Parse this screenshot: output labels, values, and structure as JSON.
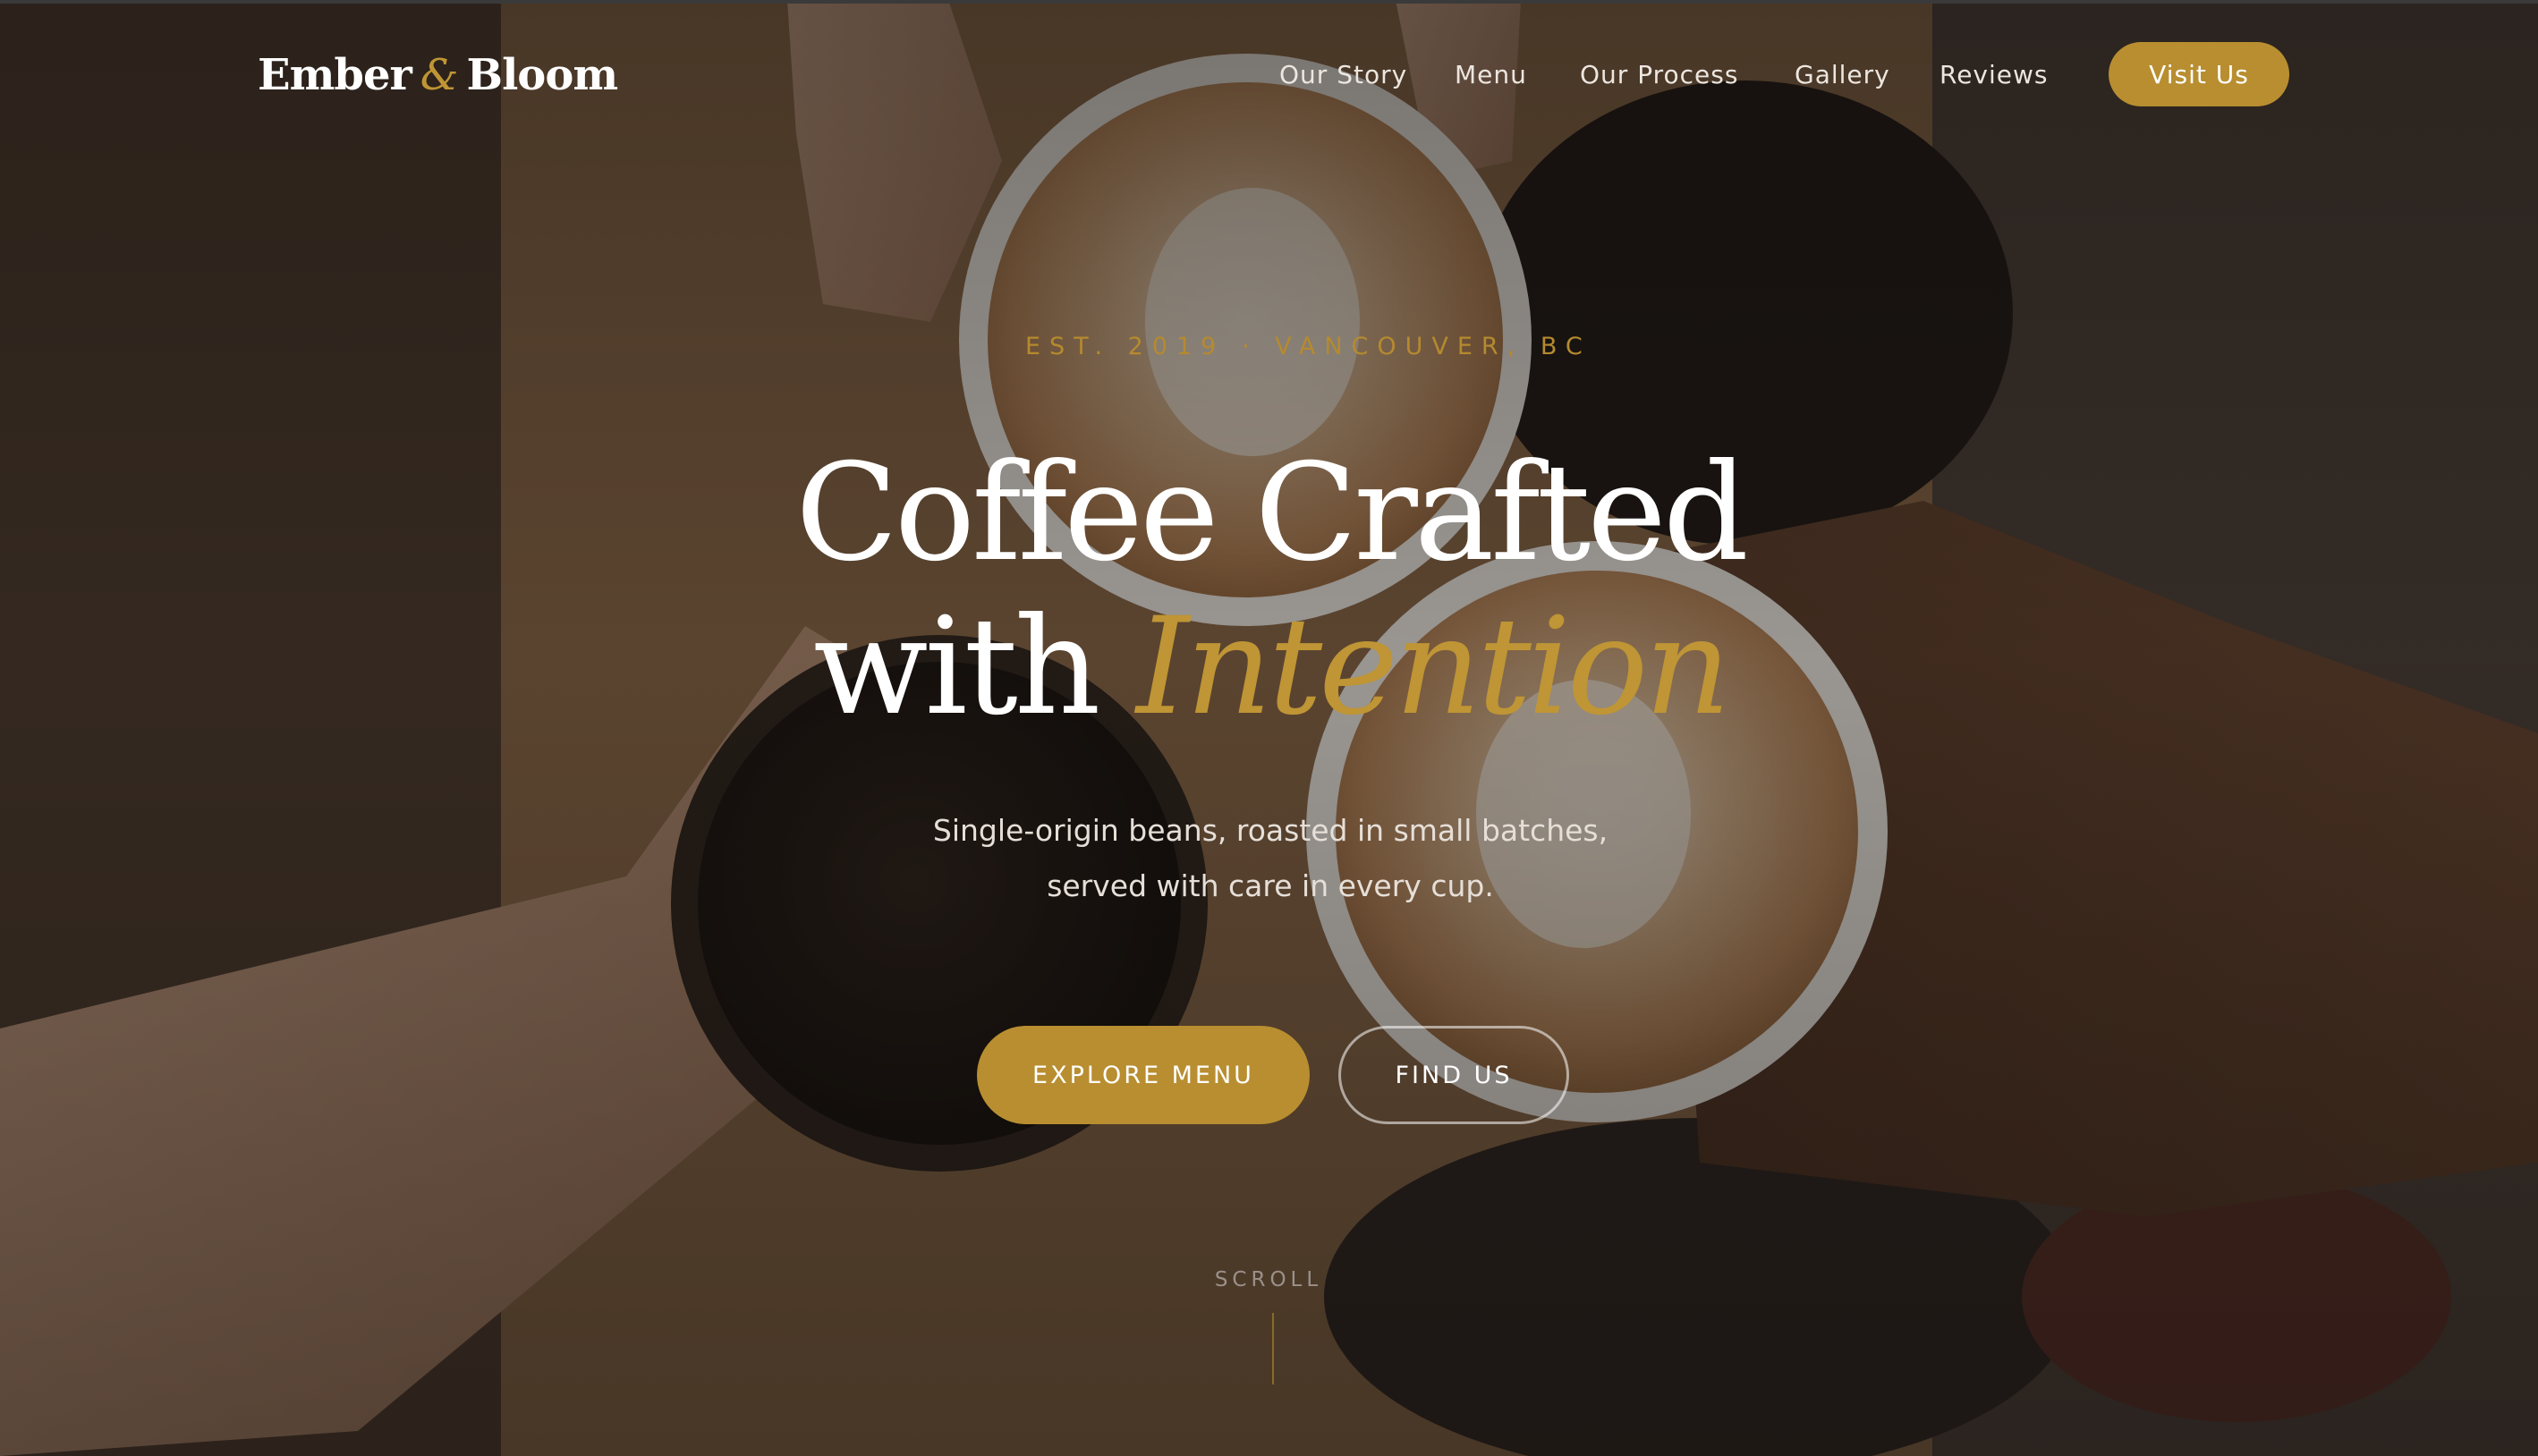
{
  "brand": {
    "name_part1": "Ember",
    "ampersand": "&",
    "name_part2": "Bloom",
    "accent_color": "#b88e30"
  },
  "nav": {
    "links": [
      "Our Story",
      "Menu",
      "Our Process",
      "Gallery",
      "Reviews"
    ],
    "cta_label": "Visit Us"
  },
  "hero": {
    "kicker": "EST. 2019 · VANCOUVER, BC",
    "headline_line1": "Coffee Crafted",
    "headline_line2_plain": "with",
    "headline_line2_accent": "Intention",
    "subtitle_line1": "Single-origin beans, roasted in small batches,",
    "subtitle_line2": "served with care in every cup.",
    "primary_button": "EXPLORE MENU",
    "secondary_button": "FIND US",
    "scroll_label": "SCROLL",
    "background_image": "coffee-toast-photo"
  }
}
